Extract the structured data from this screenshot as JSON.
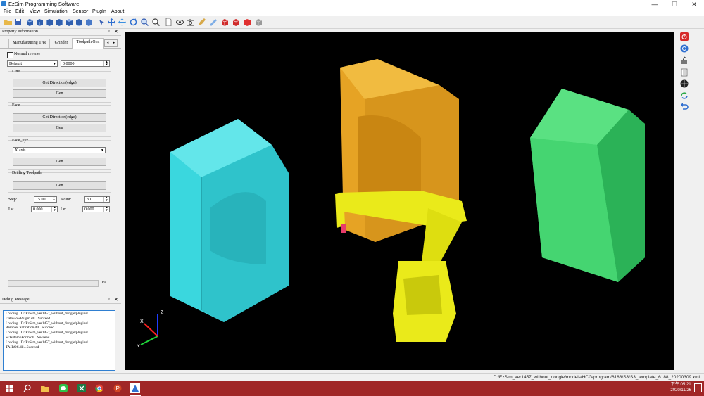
{
  "app": {
    "title": "EzSim Programming Software",
    "window_controls": {
      "minimize": "—",
      "maximize": "☐",
      "close": "✕"
    }
  },
  "menu": [
    "File",
    "Edit",
    "View",
    "Simulation",
    "Sensor",
    "PlugIn",
    "About"
  ],
  "toolbar_icons": [
    "open-folder-icon",
    "save-icon",
    "view-cube-front-icon",
    "view-cube-back-icon",
    "view-cube-left-icon",
    "view-cube-right-icon",
    "view-cube-top-icon",
    "view-cube-bottom-icon",
    "view-iso-icon",
    "select-arrow-icon",
    "pan-icon",
    "rotate-icon",
    "zoom-window-icon",
    "zoom-icon",
    "document-icon",
    "wireframe-icon",
    "eye-icon",
    "camera-icon",
    "pen-icon",
    "measure-icon",
    "red-cube-icon",
    "red-cube-icon",
    "red-cube-icon",
    "gray-cube-icon"
  ],
  "property_panel": {
    "title": "Property Information",
    "pin": "▫",
    "close": "✕",
    "tabs": [
      "Manufacturing Tree",
      "Grinder",
      "Toolpath Gen"
    ],
    "active_tab": "Toolpath Gen",
    "normal_reverse_label": "Normal reverse",
    "mode_select": "Default",
    "mode_value": "0.0000",
    "line": {
      "title": "Line",
      "get_direction": "Get Direction(edge)",
      "gen": "Gen"
    },
    "face": {
      "title": "Face",
      "get_direction": "Get Direction(edge)",
      "gen": "Gen"
    },
    "face_xyz": {
      "title": "Face_xyz",
      "axis_select": "X axis",
      "gen": "Gen"
    },
    "drilling": {
      "title": "Drilling Toolpath",
      "gen": "Gen"
    },
    "params": {
      "step_label": "Step:",
      "step_value": "15.00",
      "point_label": "Point:",
      "point_value": "30",
      "ls_label": "Ls:",
      "ls_value": "0.000",
      "le_label": "Le:",
      "le_value": "0.000"
    },
    "progress": {
      "value": 0,
      "label": "0%"
    }
  },
  "debug_panel": {
    "title": "Debug Message",
    "lines": [
      "Loading...D:/EzSim_ver1457_without_dongle/plugins/",
      "DataFlowPlugin.dll...Succeed",
      "Loading...D:/EzSim_ver1457_without_dongle/plugins/",
      "RemoteCalibration.dll...Succeed",
      "Loading...D:/EzSim_ver1457_without_dongle/plugins/",
      "SDKdemoForm.dll...Succeed",
      "Loading...D:/EzSim_ver1457_without_dongle/plugins/",
      "TAIROS.dll...Succeed"
    ]
  },
  "viewport": {
    "axis_labels": {
      "x": "X",
      "y": "Y",
      "z": "Z"
    },
    "colors": {
      "cyan_machine": "#3ad7de",
      "orange_machine": "#e6a324",
      "green_machine": "#3cd46a",
      "robot": "#eaea1a"
    }
  },
  "right_toolbar_icons": [
    "power-icon",
    "refresh-icon",
    "robot-icon",
    "document-list-icon",
    "globe-icon",
    "sync-icon",
    "undo-icon"
  ],
  "status": {
    "path": "D:/EzSim_ver1457_without_dongle/models/HCG/program/6188/S3/S3_template_6188_20200309.xml"
  },
  "taskbar": {
    "icons": [
      "windows-start-icon",
      "search-icon",
      "file-explorer-icon",
      "line-app-icon",
      "excel-icon",
      "chrome-icon",
      "powerpoint-icon",
      "ezsim-app-icon"
    ],
    "time": "下午 05:21",
    "date": "2020/11/26"
  }
}
